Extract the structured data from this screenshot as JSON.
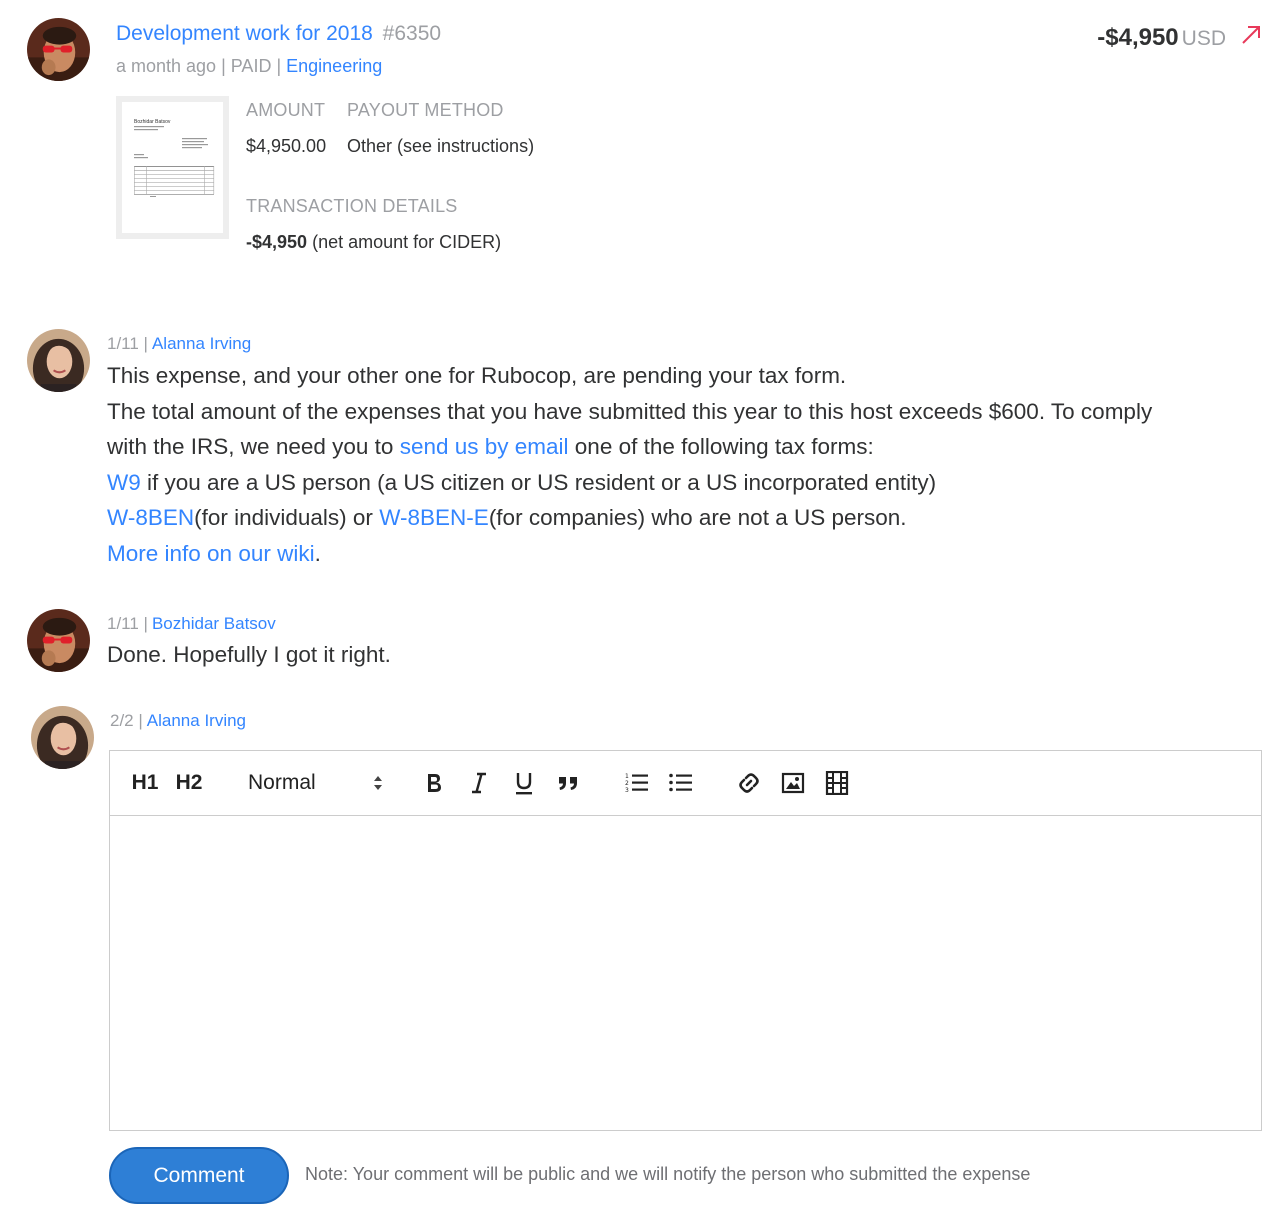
{
  "expense": {
    "title": "Development work for 2018",
    "number": "#6350",
    "time": "a month ago",
    "status": "PAID",
    "category": "Engineering",
    "amount": "-$4,950",
    "currency": "USD",
    "receipt": {
      "name": "Bozhidar Batsov"
    },
    "amount_label": "AMOUNT",
    "amount_value": "$4,950.00",
    "payout_label": "PAYOUT METHOD",
    "payout_value": "Other (see instructions)",
    "transaction_label": "TRANSACTION DETAILS",
    "transaction_amount": "-$4,950",
    "transaction_note": "(net amount for CIDER)"
  },
  "comments": [
    {
      "date": "1/11",
      "author": "Alanna Irving",
      "line1": "This expense, and your other one for Rubocop, are pending your tax form.",
      "line2": "The total amount of the expenses that you have submitted this year to this host exceeds $600. To comply",
      "line3_pre": "with the IRS, we need you to",
      "line3_link": "send us by email",
      "line3_post": "one of the following tax forms:",
      "w9_link": "W9",
      "w9_text": "if you are a US person (a US citizen or US resident or a US incorporated entity)",
      "w8ben_link": "W-8BEN",
      "w8ben_text": "(for individuals) or",
      "w8bene_link": "W-8BEN-E",
      "w8bene_text": "(for companies) who are not a US person.",
      "wiki_link": "More info on our wiki",
      "wiki_after": "."
    },
    {
      "date": "1/11",
      "author": "Bozhidar Batsov",
      "text": "Done. Hopefully I got it right."
    }
  ],
  "new_comment": {
    "date": "2/2",
    "author": "Alanna Irving",
    "toolbar": {
      "h1": "H1",
      "h2": "H2",
      "format": "Normal"
    },
    "button": "Comment",
    "note": "Note: Your comment will be public and we will notify the person who submitted the expense"
  },
  "colors": {
    "link": "#3385ff",
    "negative_arrow": "#e8395a",
    "button": "#2e7fd6"
  }
}
